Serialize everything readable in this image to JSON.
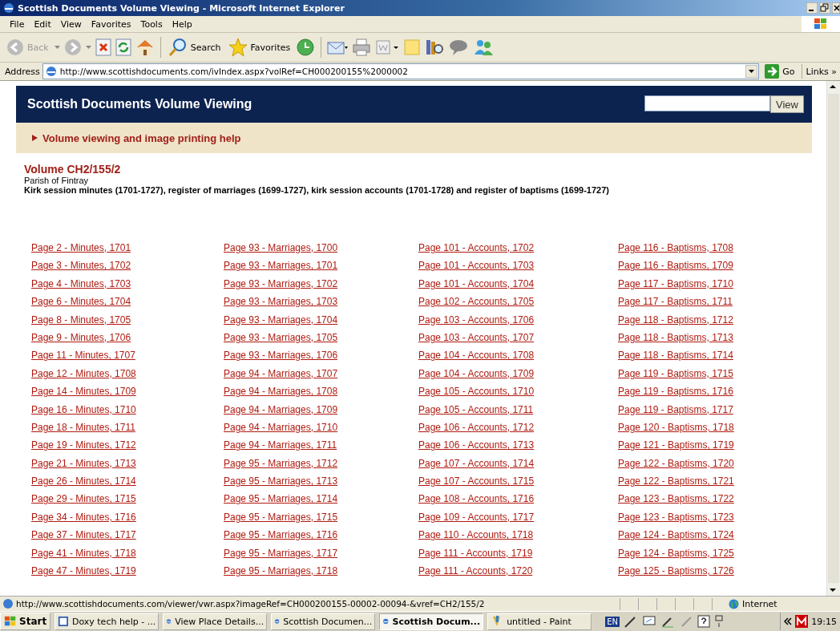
{
  "window": {
    "title": "Scottish Documents Volume Viewing - Microsoft Internet Explorer"
  },
  "menu": [
    "File",
    "Edit",
    "View",
    "Favorites",
    "Tools",
    "Help"
  ],
  "toolbar": {
    "back": "Back",
    "search": "Search",
    "favorites": "Favorites"
  },
  "address": {
    "label": "Address",
    "url": "http://www.scottishdocuments.com/ivIndex.aspx?volRef=CH000200155%2000002",
    "go": "Go",
    "links": "Links »"
  },
  "page": {
    "site_title": "Scottish Documents Volume Viewing",
    "search_button": "View",
    "help_link": "Volume viewing and image printing help",
    "volume": "Volume CH2/155/2",
    "parish": "Parish of Fintray",
    "description": "Kirk session minutes (1701-1727), register of marriages (1699-1727), kirk session accounts (1701-1728) and register of baptisms (1699-1727)"
  },
  "link_columns": [
    [
      "Page 2 - Minutes, 1701",
      "Page 3 - Minutes, 1702",
      "Page 4 - Minutes, 1703",
      "Page 6 - Minutes, 1704",
      "Page 8 - Minutes, 1705",
      "Page 9 - Minutes, 1706",
      "Page 11 - Minutes, 1707",
      "Page 12 - Minutes, 1708",
      "Page 14 - Minutes, 1709",
      "Page 16 - Minutes, 1710",
      "Page 18 - Minutes, 1711",
      "Page 19 - Minutes, 1712",
      "Page 21 - Minutes, 1713",
      "Page 26 - Minutes, 1714",
      "Page 29 - Minutes, 1715",
      "Page 34 - Minutes, 1716",
      "Page 37 - Minutes, 1717",
      "Page 41 - Minutes, 1718",
      "Page 47 - Minutes, 1719"
    ],
    [
      "Page 93 - Marriages, 1700",
      "Page 93 - Marriages, 1701",
      "Page 93 - Marriages, 1702",
      "Page 93 - Marriages, 1703",
      "Page 93 - Marriages, 1704",
      "Page 93 - Marriages, 1705",
      "Page 93 - Marriages, 1706",
      "Page 94 - Marriages, 1707",
      "Page 94 - Marriages, 1708",
      "Page 94 - Marriages, 1709",
      "Page 94 - Marriages, 1710",
      "Page 94 - Marriages, 1711",
      "Page 95 - Marriages, 1712",
      "Page 95 - Marriages, 1713",
      "Page 95 - Marriages, 1714",
      "Page 95 - Marriages, 1715",
      "Page 95 - Marriages, 1716",
      "Page 95 - Marriages, 1717",
      "Page 95 - Marriages, 1718"
    ],
    [
      "Page 101 - Accounts, 1702",
      "Page 101 - Accounts, 1703",
      "Page 101 - Accounts, 1704",
      "Page 102 - Accounts, 1705",
      "Page 103 - Accounts, 1706",
      "Page 103 - Accounts, 1707",
      "Page 104 - Accounts, 1708",
      "Page 104 - Accounts, 1709",
      "Page 105 - Accounts, 1710",
      "Page 105 - Accounts, 1711",
      "Page 106 - Accounts, 1712",
      "Page 106 - Accounts, 1713",
      "Page 107 - Accounts, 1714",
      "Page 107 - Accounts, 1715",
      "Page 108 - Accounts, 1716",
      "Page 109 - Accounts, 1717",
      "Page 110 - Accounts, 1718",
      "Page 111 - Accounts, 1719",
      "Page 111 - Accounts, 1720"
    ],
    [
      "Page 116 - Baptisms, 1708",
      "Page 116 - Baptisms, 1709",
      "Page 117 - Baptisms, 1710",
      "Page 117 - Baptisms, 1711",
      "Page 118 - Baptisms, 1712",
      "Page 118 - Baptisms, 1713",
      "Page 118 - Baptisms, 1714",
      "Page 119 - Baptisms, 1715",
      "Page 119 - Baptisms, 1716",
      "Page 119 - Baptisms, 1717",
      "Page 120 - Baptisms, 1718",
      "Page 121 - Baptisms, 1719",
      "Page 122 - Baptisms, 1720",
      "Page 122 - Baptisms, 1721",
      "Page 123 - Baptisms, 1722",
      "Page 123 - Baptisms, 1723",
      "Page 124 - Baptisms, 1724",
      "Page 124 - Baptisms, 1725",
      "Page 125 - Baptisms, 1726"
    ]
  ],
  "status_bar": {
    "url": "http://www.scottishdocuments.com/viewer/vwr.aspx?imageRef=CH000200155-00002-00094-&vref=CH2/155/2",
    "zone": "Internet"
  },
  "taskbar": {
    "start": "Start",
    "tasks": [
      {
        "label": "Doxy tech help - ...",
        "selected": false
      },
      {
        "label": "View Place Details...",
        "selected": false
      },
      {
        "label": "Scottish Documen...",
        "selected": false
      },
      {
        "label": "Scottish Docum...",
        "selected": true
      },
      {
        "label": "untitled - Paint",
        "selected": false
      }
    ],
    "language": "EN",
    "clock": "19:15"
  }
}
